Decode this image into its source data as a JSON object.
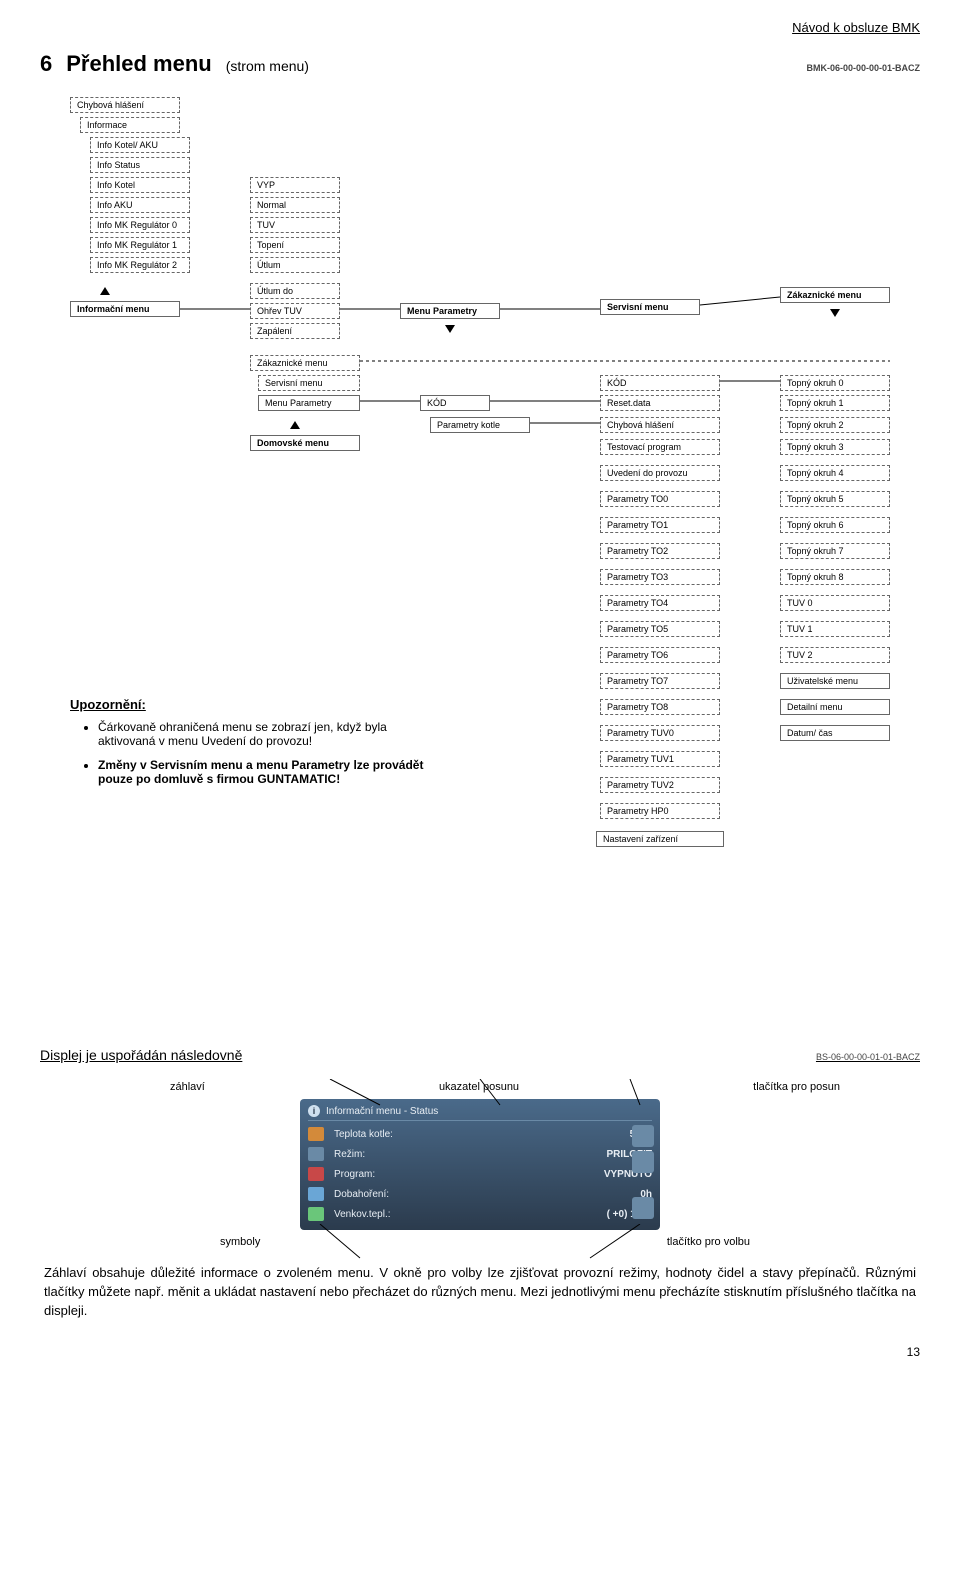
{
  "header": {
    "doc_title": "Návod k obsluze BMK"
  },
  "chapter": {
    "number": "6",
    "title": "Přehled menu",
    "subtitle": "(strom menu)",
    "code": "BMK-06-00-00-00-01-BACZ"
  },
  "tree": {
    "left_col": [
      "Chybová hlášení",
      "Informace",
      "Info Kotel/ AKU",
      "Info Status",
      "Info Kotel",
      "Info AKU",
      "Info MK Regulátor 0",
      "Info MK Regulátor 1",
      "Info MK Regulátor 2"
    ],
    "info_menu": "Informační menu",
    "modes": [
      "VYP",
      "Normal",
      "TUV",
      "Topení",
      "Útlum",
      "Útlum do",
      "Ohřev TUV",
      "Zapálení"
    ],
    "menu_param": "Menu Parametry",
    "servis_menu": "Servisní menu",
    "zak_menu": "Zákaznické menu",
    "sub_list": [
      "Zákaznické menu",
      "Servisní menu",
      "Menu Parametry"
    ],
    "domov": "Domovské menu",
    "code_hdr": "KÓD",
    "param_kotle": "Parametry kotle",
    "col3": [
      "KÓD",
      "Reset.data",
      "Chybová hlášení",
      "Testovací program",
      "Uvedení do provozu",
      "Parametry TO0",
      "Parametry TO1",
      "Parametry TO2",
      "Parametry TO3",
      "Parametry TO4",
      "Parametry TO5",
      "Parametry TO6",
      "Parametry TO7",
      "Parametry TO8",
      "Parametry TUV0",
      "Parametry TUV1",
      "Parametry TUV2",
      "Parametry HP0",
      "Nastavení zařízení"
    ],
    "col4": [
      "Topný okruh 0",
      "Topný okruh 1",
      "Topný okruh 2",
      "Topný okruh 3",
      "Topný okruh 4",
      "Topný okruh 5",
      "Topný okruh 6",
      "Topný okruh 7",
      "Topný okruh 8",
      "TUV 0",
      "TUV 1",
      "TUV 2",
      "Uživatelské menu",
      "Detailní menu",
      "Datum/ čas"
    ]
  },
  "notice": {
    "heading": "Upozornění:",
    "bullets": [
      "Čárkovaně ohraničená menu se zobrazí jen, když byla aktivovaná v menu Uvedení do provozu!",
      "Změny v Servisním menu a menu Parametry lze provádět pouze po domluvě s firmou GUNTAMATIC!"
    ]
  },
  "display": {
    "heading": "Displej je uspořádán následovně",
    "code": "BS-06-00-00-01-01-BACZ",
    "label_top1": "záhlaví",
    "label_top2": "ukazatel posunu",
    "label_top3": "tlačítka pro posun",
    "label_bottom1": "symboly",
    "label_bottom2": "tlačítko pro volbu",
    "screenshot": {
      "title": "Informační menu - Status",
      "rows": [
        {
          "label": "Teplota kotle:",
          "value": "50°C"
        },
        {
          "label": "Režim:",
          "value": "PRILOZIT"
        },
        {
          "label": "Program:",
          "value": "VYPNUTO"
        },
        {
          "label": "Dobahoření:",
          "value": "0h"
        },
        {
          "label": "Venkov.tepl.:",
          "value": "( +0) 11°C"
        }
      ]
    }
  },
  "body_text": "Záhlaví obsahuje důležité informace o zvoleném menu. V okně pro volby lze zjišťovat provozní režimy, hodnoty čidel a stavy přepínačů. Různými tlačítky můžete např. měnit a ukládat nastavení nebo přecházet do různých menu. Mezi jednotlivými menu přecházíte stisknutím příslušného tlačítka na displeji.",
  "page_number": "13"
}
